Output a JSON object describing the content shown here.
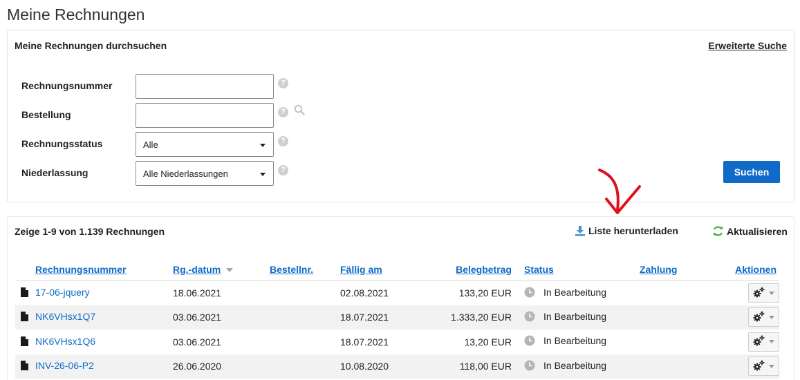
{
  "page_title": "Meine Rechnungen",
  "search": {
    "heading": "Meine Rechnungen durchsuchen",
    "advanced_link": "Erweiterte Suche",
    "fields": {
      "invoice_number": {
        "label": "Rechnungsnummer",
        "value": ""
      },
      "order": {
        "label": "Bestellung",
        "value": ""
      },
      "status": {
        "label": "Rechnungsstatus",
        "selected": "Alle"
      },
      "branch": {
        "label": "Niederlassung",
        "selected": "Alle Niederlassungen"
      }
    },
    "help_glyph": "?",
    "search_button": "Suchen"
  },
  "results": {
    "count_text": "Zeige 1-9 von 1.139 Rechnungen",
    "download_label": "Liste herunterladen",
    "refresh_label": "Aktualisieren",
    "columns": [
      "Rechnungsnummer",
      "Rg.-datum",
      "Bestellnr.",
      "Fällig am",
      "Belegbetrag",
      "Status",
      "Zahlung",
      "Aktionen"
    ],
    "rows": [
      {
        "number": "17-06-jquery",
        "date": "18.06.2021",
        "order": "",
        "due": "02.08.2021",
        "amount": "133,20 EUR",
        "status": "In Bearbeitung",
        "payment": ""
      },
      {
        "number": "NK6VHsx1Q7",
        "date": "03.06.2021",
        "order": "",
        "due": "18.07.2021",
        "amount": "1.333,20 EUR",
        "status": "In Bearbeitung",
        "payment": ""
      },
      {
        "number": "NK6VHsx1Q6",
        "date": "03.06.2021",
        "order": "",
        "due": "18.07.2021",
        "amount": "13,20 EUR",
        "status": "In Bearbeitung",
        "payment": ""
      },
      {
        "number": "INV-26-06-P2",
        "date": "26.06.2020",
        "order": "",
        "due": "10.08.2020",
        "amount": "118,00 EUR",
        "status": "In Bearbeitung",
        "payment": ""
      }
    ]
  },
  "icons": {
    "document": "document-icon",
    "clock": "clock-icon",
    "gear": "gear-icon",
    "download": "download-icon",
    "refresh": "refresh-icon",
    "annotation_arrow": "red-arrow-icon"
  },
  "colors": {
    "link_blue": "#0f6bc7",
    "button_blue": "#0f6bc7",
    "refresh_green": "#3fb24f",
    "download_blue": "#4a90d9",
    "annotation_red": "#e0101c",
    "row_alt": "#f2f2f2"
  }
}
